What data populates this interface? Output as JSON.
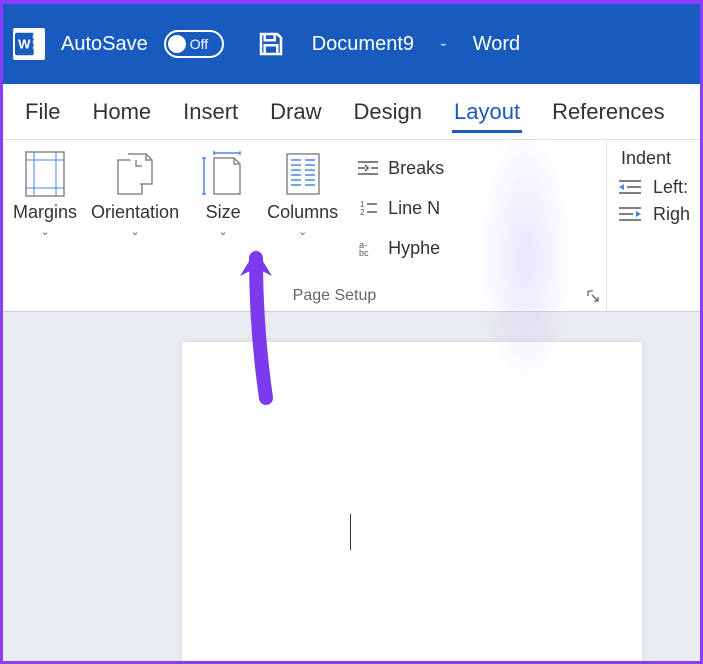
{
  "titleBar": {
    "autosave": "AutoSave",
    "toggleState": "Off",
    "documentName": "Document9",
    "appName": "Word"
  },
  "tabs": [
    "File",
    "Home",
    "Insert",
    "Draw",
    "Design",
    "Layout",
    "References"
  ],
  "activeTab": "Layout",
  "ribbon": {
    "pageSetup": {
      "label": "Page Setup",
      "margins": "Margins",
      "orientation": "Orientation",
      "size": "Size",
      "columns": "Columns",
      "breaks": "Breaks",
      "lineNumbers": "Line N",
      "hyphenation": "Hyphe"
    },
    "indent": {
      "title": "Indent",
      "left": "Left:",
      "right": "Righ"
    }
  }
}
